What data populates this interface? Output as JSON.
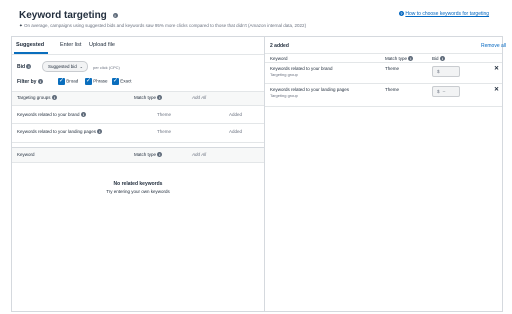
{
  "header": {
    "title": "Keyword targeting",
    "subtitle": "On average, campaigns using suggested bids and keywords saw 95% more clicks compared to those that didn't (Amazon internal data, 2022)",
    "help_link": "How to choose keywords for targeting"
  },
  "left": {
    "tabs": [
      "Suggested",
      "Enter list",
      "Upload file"
    ],
    "bid_label": "Bid",
    "bid_select": "Suggested bid",
    "bid_note": "per click (CPC)",
    "filter_label": "Filter by",
    "filters": [
      "Broad",
      "Phrase",
      "Exact"
    ],
    "groups_table": {
      "col_group": "Targeting groups",
      "col_match": "Match type",
      "add_all": "Add All",
      "rows": [
        {
          "name": "Keywords related to your brand",
          "match": "Theme",
          "status": "Added"
        },
        {
          "name": "Keywords related to your landing pages",
          "match": "Theme",
          "status": "Added"
        }
      ]
    },
    "keyword_table": {
      "col_keyword": "Keyword",
      "col_match": "Match type",
      "add_all": "Add All",
      "empty_title": "No related keywords",
      "empty_hint": "Try entering your own keywords"
    }
  },
  "right": {
    "count": "2 added",
    "remove_all": "Remove all",
    "col_keyword": "Keyword",
    "col_match": "Match type",
    "col_bid": "Bid",
    "rows": [
      {
        "name": "Keywords related to your brand",
        "sub": "Targeting group",
        "match": "Theme",
        "bid_prefix": "$",
        "bid_value": ""
      },
      {
        "name": "Keywords related to your landing pages",
        "sub": "Targeting group",
        "match": "Theme",
        "bid_prefix": "$",
        "bid_value": "–"
      }
    ]
  },
  "colors": {
    "accent": "#0a6ebd",
    "link": "#0066c0",
    "text": "#232f3e"
  }
}
